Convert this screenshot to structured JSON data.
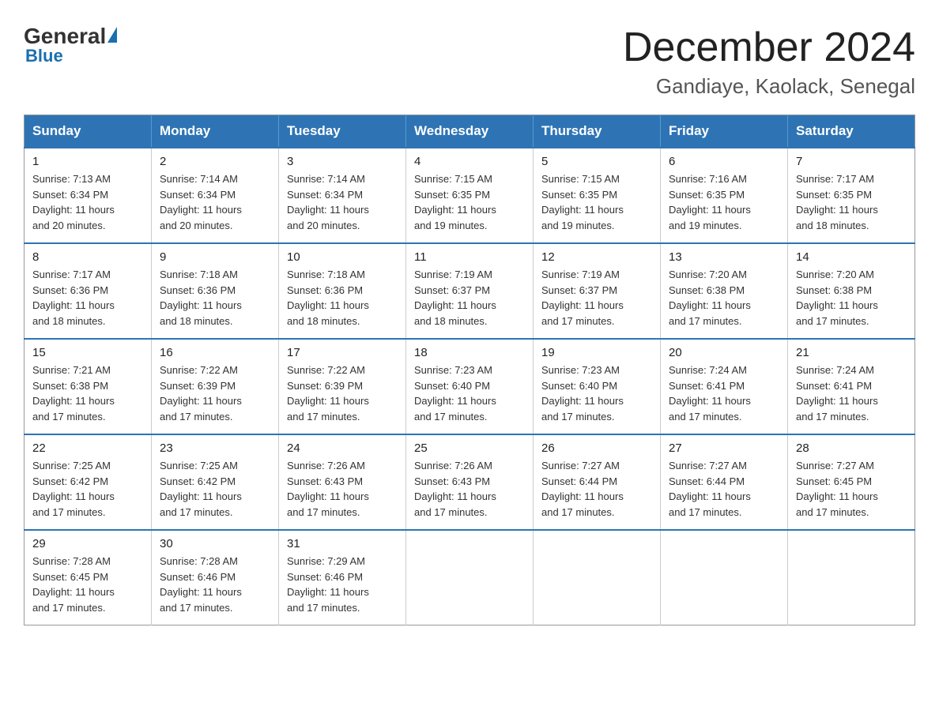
{
  "header": {
    "logo_general": "General",
    "logo_blue": "Blue",
    "month_title": "December 2024",
    "location": "Gandiaye, Kaolack, Senegal"
  },
  "days_of_week": [
    "Sunday",
    "Monday",
    "Tuesday",
    "Wednesday",
    "Thursday",
    "Friday",
    "Saturday"
  ],
  "weeks": [
    [
      {
        "day": "1",
        "sunrise": "7:13 AM",
        "sunset": "6:34 PM",
        "daylight": "11 hours and 20 minutes."
      },
      {
        "day": "2",
        "sunrise": "7:14 AM",
        "sunset": "6:34 PM",
        "daylight": "11 hours and 20 minutes."
      },
      {
        "day": "3",
        "sunrise": "7:14 AM",
        "sunset": "6:34 PM",
        "daylight": "11 hours and 20 minutes."
      },
      {
        "day": "4",
        "sunrise": "7:15 AM",
        "sunset": "6:35 PM",
        "daylight": "11 hours and 19 minutes."
      },
      {
        "day": "5",
        "sunrise": "7:15 AM",
        "sunset": "6:35 PM",
        "daylight": "11 hours and 19 minutes."
      },
      {
        "day": "6",
        "sunrise": "7:16 AM",
        "sunset": "6:35 PM",
        "daylight": "11 hours and 19 minutes."
      },
      {
        "day": "7",
        "sunrise": "7:17 AM",
        "sunset": "6:35 PM",
        "daylight": "11 hours and 18 minutes."
      }
    ],
    [
      {
        "day": "8",
        "sunrise": "7:17 AM",
        "sunset": "6:36 PM",
        "daylight": "11 hours and 18 minutes."
      },
      {
        "day": "9",
        "sunrise": "7:18 AM",
        "sunset": "6:36 PM",
        "daylight": "11 hours and 18 minutes."
      },
      {
        "day": "10",
        "sunrise": "7:18 AM",
        "sunset": "6:36 PM",
        "daylight": "11 hours and 18 minutes."
      },
      {
        "day": "11",
        "sunrise": "7:19 AM",
        "sunset": "6:37 PM",
        "daylight": "11 hours and 18 minutes."
      },
      {
        "day": "12",
        "sunrise": "7:19 AM",
        "sunset": "6:37 PM",
        "daylight": "11 hours and 17 minutes."
      },
      {
        "day": "13",
        "sunrise": "7:20 AM",
        "sunset": "6:38 PM",
        "daylight": "11 hours and 17 minutes."
      },
      {
        "day": "14",
        "sunrise": "7:20 AM",
        "sunset": "6:38 PM",
        "daylight": "11 hours and 17 minutes."
      }
    ],
    [
      {
        "day": "15",
        "sunrise": "7:21 AM",
        "sunset": "6:38 PM",
        "daylight": "11 hours and 17 minutes."
      },
      {
        "day": "16",
        "sunrise": "7:22 AM",
        "sunset": "6:39 PM",
        "daylight": "11 hours and 17 minutes."
      },
      {
        "day": "17",
        "sunrise": "7:22 AM",
        "sunset": "6:39 PM",
        "daylight": "11 hours and 17 minutes."
      },
      {
        "day": "18",
        "sunrise": "7:23 AM",
        "sunset": "6:40 PM",
        "daylight": "11 hours and 17 minutes."
      },
      {
        "day": "19",
        "sunrise": "7:23 AM",
        "sunset": "6:40 PM",
        "daylight": "11 hours and 17 minutes."
      },
      {
        "day": "20",
        "sunrise": "7:24 AM",
        "sunset": "6:41 PM",
        "daylight": "11 hours and 17 minutes."
      },
      {
        "day": "21",
        "sunrise": "7:24 AM",
        "sunset": "6:41 PM",
        "daylight": "11 hours and 17 minutes."
      }
    ],
    [
      {
        "day": "22",
        "sunrise": "7:25 AM",
        "sunset": "6:42 PM",
        "daylight": "11 hours and 17 minutes."
      },
      {
        "day": "23",
        "sunrise": "7:25 AM",
        "sunset": "6:42 PM",
        "daylight": "11 hours and 17 minutes."
      },
      {
        "day": "24",
        "sunrise": "7:26 AM",
        "sunset": "6:43 PM",
        "daylight": "11 hours and 17 minutes."
      },
      {
        "day": "25",
        "sunrise": "7:26 AM",
        "sunset": "6:43 PM",
        "daylight": "11 hours and 17 minutes."
      },
      {
        "day": "26",
        "sunrise": "7:27 AM",
        "sunset": "6:44 PM",
        "daylight": "11 hours and 17 minutes."
      },
      {
        "day": "27",
        "sunrise": "7:27 AM",
        "sunset": "6:44 PM",
        "daylight": "11 hours and 17 minutes."
      },
      {
        "day": "28",
        "sunrise": "7:27 AM",
        "sunset": "6:45 PM",
        "daylight": "11 hours and 17 minutes."
      }
    ],
    [
      {
        "day": "29",
        "sunrise": "7:28 AM",
        "sunset": "6:45 PM",
        "daylight": "11 hours and 17 minutes."
      },
      {
        "day": "30",
        "sunrise": "7:28 AM",
        "sunset": "6:46 PM",
        "daylight": "11 hours and 17 minutes."
      },
      {
        "day": "31",
        "sunrise": "7:29 AM",
        "sunset": "6:46 PM",
        "daylight": "11 hours and 17 minutes."
      },
      {
        "day": "",
        "sunrise": "",
        "sunset": "",
        "daylight": ""
      },
      {
        "day": "",
        "sunrise": "",
        "sunset": "",
        "daylight": ""
      },
      {
        "day": "",
        "sunrise": "",
        "sunset": "",
        "daylight": ""
      },
      {
        "day": "",
        "sunrise": "",
        "sunset": "",
        "daylight": ""
      }
    ]
  ],
  "labels": {
    "sunrise": "Sunrise:",
    "sunset": "Sunset:",
    "daylight": "Daylight:"
  }
}
